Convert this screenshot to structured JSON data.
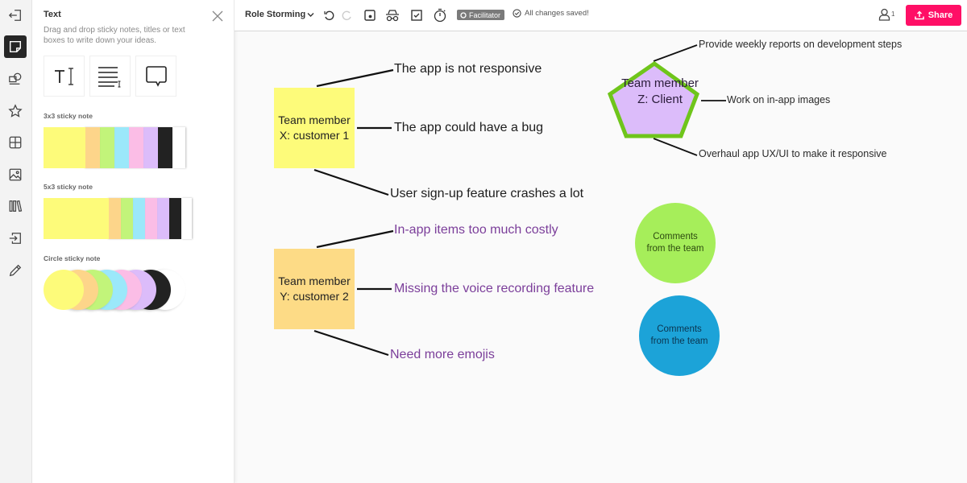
{
  "rail": {
    "items": [
      {
        "name": "exit-icon"
      },
      {
        "name": "sticky-note-icon",
        "active": true
      },
      {
        "name": "shapes-icon"
      },
      {
        "name": "star-icon"
      },
      {
        "name": "grid-icon"
      },
      {
        "name": "image-icon"
      },
      {
        "name": "library-icon"
      },
      {
        "name": "import-icon"
      },
      {
        "name": "pencil-icon"
      }
    ]
  },
  "panel": {
    "title": "Text",
    "description": "Drag and drop sticky notes, titles or text boxes to write down your ideas.",
    "tools": [
      {
        "name": "text-title-tool",
        "icon": "text-cursor-icon"
      },
      {
        "name": "text-box-tool",
        "icon": "paragraph-icon"
      },
      {
        "name": "speech-bubble-tool",
        "icon": "speech-bubble-icon"
      }
    ],
    "sections": {
      "sticky3x3": "3x3 sticky note",
      "sticky5x3": "5x3 sticky note",
      "circle": "Circle sticky note"
    },
    "palette": [
      "#fdfb7a",
      "#fdd58a",
      "#c2f47a",
      "#9be8fa",
      "#fbbde6",
      "#dcbcfa",
      "#222222",
      "#ffffff"
    ]
  },
  "topbar": {
    "board_title": "Role Storming",
    "facilitator_label": "Facilitator",
    "saved_status": "All changes saved!",
    "user_count": "1",
    "share_label": "Share"
  },
  "colors": {
    "accent": "#ff0f66",
    "purple_text": "#7b3e9a",
    "pentagon_fill": "#dcbcfa",
    "pentagon_stroke": "#6fc51b",
    "note_yellow": "#fdfb7a",
    "note_orange": "#fddb86",
    "circle_green": "#a6ee5a",
    "circle_blue": "#1ca3d8"
  },
  "canvas": {
    "note_x": "Team member X: customer 1",
    "note_x_comments": [
      "The app is not responsive",
      "The app  could have a bug",
      "User sign-up feature crashes a lot"
    ],
    "note_y": "Team member Y: customer 2",
    "note_y_comments": [
      "In-app items too much costly",
      "Missing the voice recording feature",
      "Need more emojis"
    ],
    "pentagon": "Team member Z: Client",
    "pentagon_comments": [
      "Provide weekly reports on development steps",
      "Work on in-app images",
      "Overhaul app UX/UI to make it responsive"
    ],
    "circle_green": "Comments from the team",
    "circle_blue": "Comments from the team"
  }
}
